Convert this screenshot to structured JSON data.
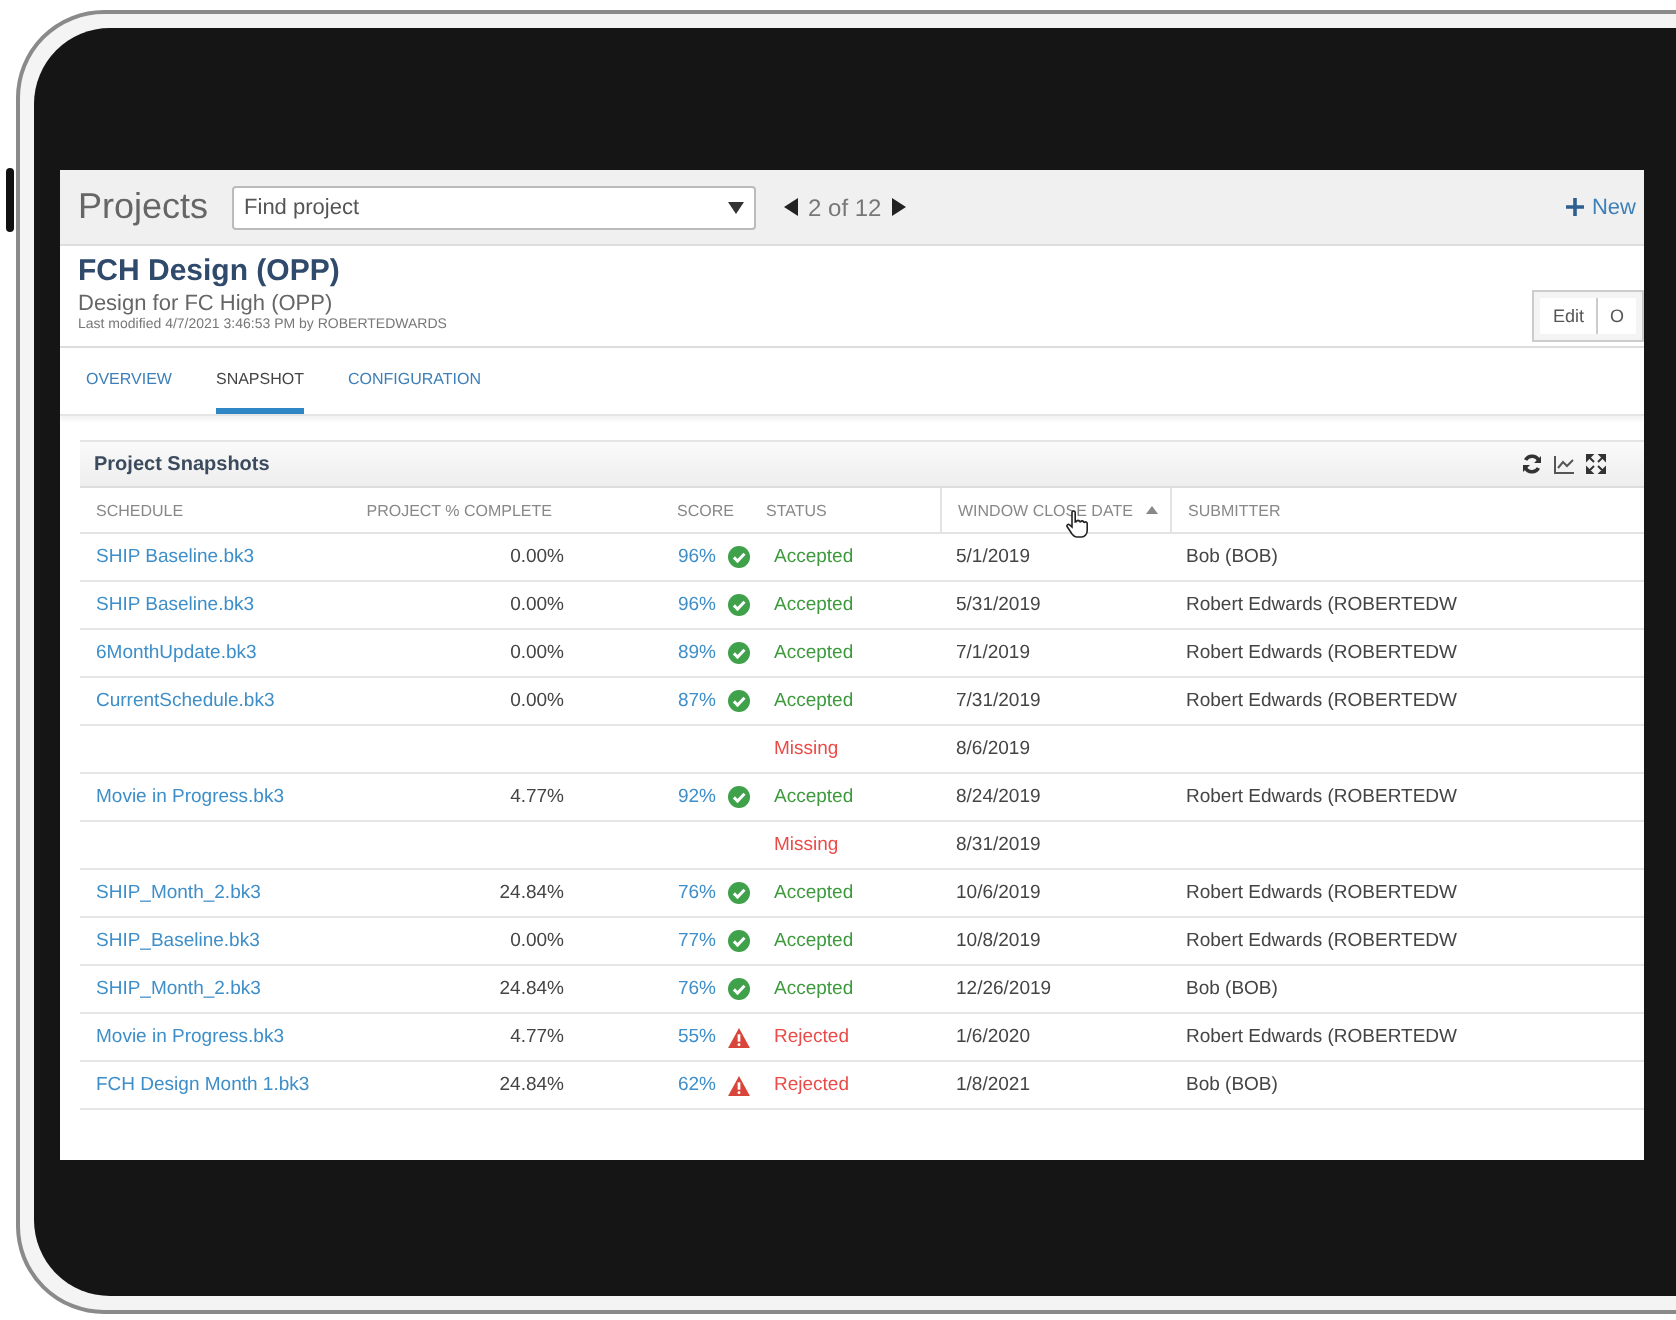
{
  "header": {
    "title": "Projects",
    "search": {
      "placeholder": "Find project"
    },
    "pager": "2 of 12",
    "new_button": "New"
  },
  "project": {
    "name": "FCH Design (OPP)",
    "description": "Design for FC High (OPP)",
    "modified": "Last modified 4/7/2021 3:46:53 PM by ROBERTEDWARDS",
    "actions": [
      "Edit",
      "O"
    ]
  },
  "tabs": [
    {
      "label": "OVERVIEW",
      "selected": false
    },
    {
      "label": "SNAPSHOT",
      "selected": true
    },
    {
      "label": "CONFIGURATION",
      "selected": false
    }
  ],
  "panel": {
    "title": "Project Snapshots",
    "columns": [
      {
        "label": "SCHEDULE",
        "sorted": false
      },
      {
        "label": "PROJECT % COMPLETE",
        "sorted": false
      },
      {
        "label": "SCORE",
        "sorted": false
      },
      {
        "label": "STATUS",
        "sorted": false
      },
      {
        "label": "WINDOW CLOSE DATE",
        "sorted": true
      },
      {
        "label": "SUBMITTER",
        "sorted": false
      }
    ],
    "rows": [
      {
        "schedule": "SHIP Baseline.bk3",
        "complete": "0.00%",
        "score": "96%",
        "status": "Accepted",
        "kind": "accepted",
        "date": "5/1/2019",
        "submitter": "Bob (BOB)"
      },
      {
        "schedule": "SHIP Baseline.bk3",
        "complete": "0.00%",
        "score": "96%",
        "status": "Accepted",
        "kind": "accepted",
        "date": "5/31/2019",
        "submitter": "Robert Edwards (ROBERTEDW"
      },
      {
        "schedule": "6MonthUpdate.bk3",
        "complete": "0.00%",
        "score": "89%",
        "status": "Accepted",
        "kind": "accepted",
        "date": "7/1/2019",
        "submitter": "Robert Edwards (ROBERTEDW"
      },
      {
        "schedule": "CurrentSchedule.bk3",
        "complete": "0.00%",
        "score": "87%",
        "status": "Accepted",
        "kind": "accepted",
        "date": "7/31/2019",
        "submitter": "Robert Edwards (ROBERTEDW"
      },
      {
        "status": "Missing",
        "kind": "missing",
        "date": "8/6/2019"
      },
      {
        "schedule": "Movie in Progress.bk3",
        "complete": "4.77%",
        "score": "92%",
        "status": "Accepted",
        "kind": "accepted",
        "date": "8/24/2019",
        "submitter": "Robert Edwards (ROBERTEDW"
      },
      {
        "status": "Missing",
        "kind": "missing",
        "date": "8/31/2019"
      },
      {
        "schedule": "SHIP_Month_2.bk3",
        "complete": "24.84%",
        "score": "76%",
        "status": "Accepted",
        "kind": "accepted",
        "date": "10/6/2019",
        "submitter": "Robert Edwards (ROBERTEDW"
      },
      {
        "schedule": "SHIP_Baseline.bk3",
        "complete": "0.00%",
        "score": "77%",
        "status": "Accepted",
        "kind": "accepted",
        "date": "10/8/2019",
        "submitter": "Robert Edwards (ROBERTEDW"
      },
      {
        "schedule": "SHIP_Month_2.bk3",
        "complete": "24.84%",
        "score": "76%",
        "status": "Accepted",
        "kind": "accepted",
        "date": "12/26/2019",
        "submitter": "Bob (BOB)"
      },
      {
        "schedule": "Movie in Progress.bk3",
        "complete": "4.77%",
        "score": "55%",
        "status": "Rejected",
        "kind": "rejected",
        "date": "1/6/2020",
        "submitter": "Robert Edwards (ROBERTEDW"
      },
      {
        "schedule": "FCH Design Month 1.bk3",
        "complete": "24.84%",
        "score": "62%",
        "status": "Rejected",
        "kind": "rejected",
        "date": "1/8/2021",
        "submitter": "Bob (BOB)"
      }
    ]
  }
}
